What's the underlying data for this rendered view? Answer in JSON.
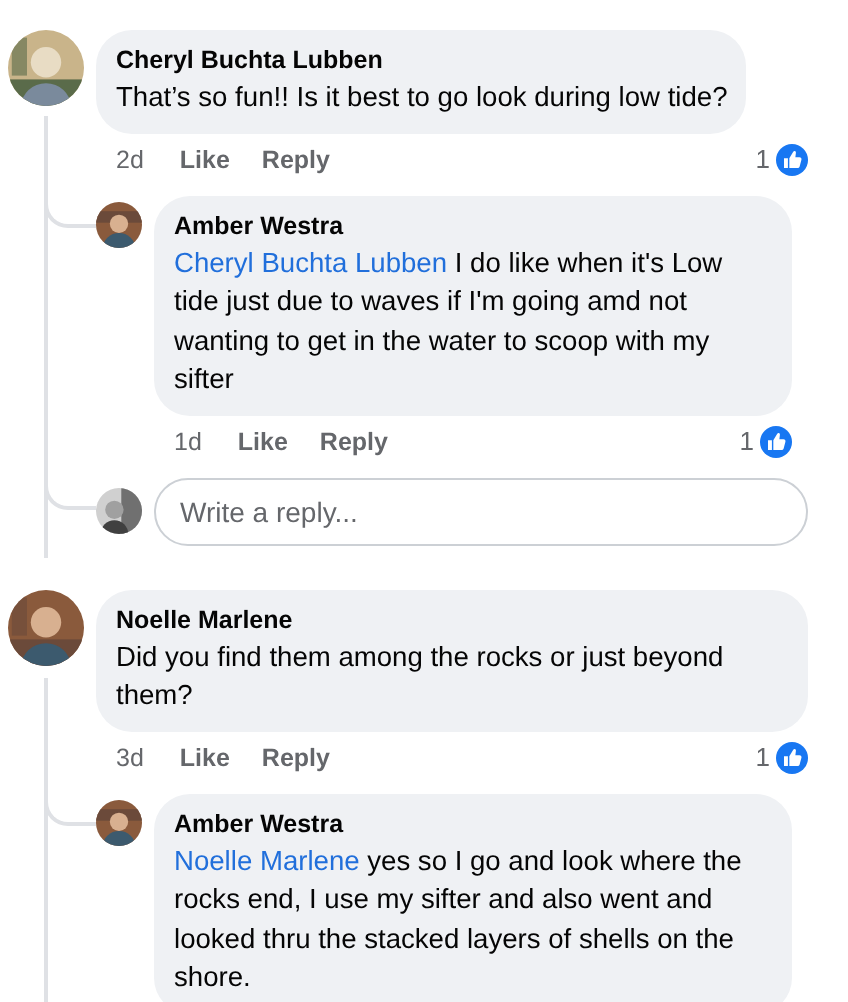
{
  "comments": [
    {
      "author": "Cheryl Buchta Lubben",
      "text": "That’s so fun!! Is it best to go look during low tide?",
      "time": "2d",
      "like_label": "Like",
      "reply_label": "Reply",
      "reaction_count": "1",
      "avatar": {
        "kind": "picture"
      },
      "replies": [
        {
          "author": "Amber Westra",
          "mention": "Cheryl Buchta Lubben",
          "text": "I do like when it's Low tide just due to waves if I'm going amd not wanting to get in the water to scoop with my sifter",
          "time": "1d",
          "like_label": "Like",
          "reply_label": "Reply",
          "reaction_count": "1",
          "avatar": {
            "kind": "picture"
          }
        }
      ],
      "reply_box": {
        "placeholder": "Write a reply..."
      }
    },
    {
      "author": "Noelle Marlene",
      "text": "Did you find them among the rocks or just beyond them?",
      "time": "3d",
      "like_label": "Like",
      "reply_label": "Reply",
      "reaction_count": "1",
      "avatar": {
        "kind": "picture"
      },
      "replies": [
        {
          "author": "Amber Westra",
          "mention": "Noelle Marlene",
          "text": "yes so I go and look where the rocks end, I use my sifter and also went and looked thru the stacked layers of shells on the shore.",
          "avatar": {
            "kind": "picture"
          }
        }
      ]
    }
  ]
}
